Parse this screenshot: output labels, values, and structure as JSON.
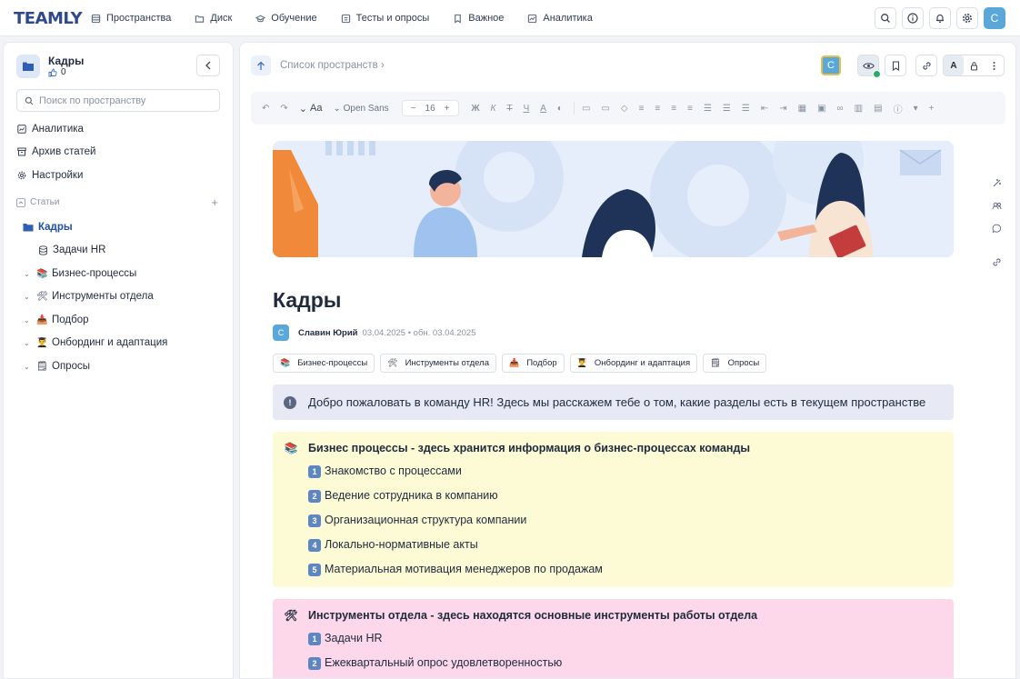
{
  "app": {
    "logo": "TEAMLY"
  },
  "nav": [
    {
      "label": "Пространства",
      "icon": "spaces-icon"
    },
    {
      "label": "Диск",
      "icon": "folder-icon"
    },
    {
      "label": "Обучение",
      "icon": "graduation-cap-icon"
    },
    {
      "label": "Тесты и опросы",
      "icon": "quiz-icon"
    },
    {
      "label": "Важное",
      "icon": "bookmark-icon"
    },
    {
      "label": "Аналитика",
      "icon": "analytics-icon"
    }
  ],
  "top_right": {
    "avatar": "С"
  },
  "sidebar": {
    "space_title": "Кадры",
    "likes": "0",
    "search_placeholder": "Поиск по пространству",
    "links": [
      {
        "label": "Аналитика",
        "icon": "analytics-icon"
      },
      {
        "label": "Архив статей",
        "icon": "archive-icon"
      },
      {
        "label": "Настройки",
        "icon": "gear-icon"
      }
    ],
    "section_label": "Статьи",
    "tree": [
      {
        "label": "Кадры",
        "emoji": "📁"
      },
      {
        "label": "Задачи HR",
        "emoji": "🗄"
      },
      {
        "label": "Бизнес-процессы",
        "emoji": "📚"
      },
      {
        "label": "Инструменты отдела",
        "emoji": "🛠"
      },
      {
        "label": "Подбор",
        "emoji": "📥"
      },
      {
        "label": "Онбординг и адаптация",
        "emoji": "👨‍🎓"
      },
      {
        "label": "Опросы",
        "emoji": "🗒"
      }
    ]
  },
  "main": {
    "breadcrumb": "Список пространств",
    "avatar": "С",
    "editor_toolbar": {
      "font": "Open Sans",
      "size": "16",
      "format_text_label": "Aa",
      "buttons": [
        "Ж",
        "К",
        "Т",
        "Ч"
      ]
    },
    "title": "Кадры",
    "author": "Славин Юрий",
    "author_initial": "С",
    "dates": "03.04.2025 • обн. 03.04.2025",
    "chips": [
      {
        "label": "Бизнес-процессы",
        "emoji": "📚"
      },
      {
        "label": "Инструменты отдела",
        "emoji": "🛠"
      },
      {
        "label": "Подбор",
        "emoji": "📥"
      },
      {
        "label": "Онбординг и адаптация",
        "emoji": "👨‍🎓"
      },
      {
        "label": "Опросы",
        "emoji": "🗒"
      }
    ],
    "notice": "Добро пожаловать в команду HR! Здесь мы расскажем тебе о том, какие разделы есть в текущем пространстве",
    "blocks": [
      {
        "emoji": "📚",
        "heading": "Бизнес процессы - здесь хранится информация о бизнес-процессах команды",
        "items": [
          {
            "num": "1",
            "label": "Знакомство с процессами"
          },
          {
            "num": "2",
            "label": "Ведение сотрудника в компанию"
          },
          {
            "num": "3",
            "label": "Организационная структура компании"
          },
          {
            "num": "4",
            "label": "Локально-нормативные акты"
          },
          {
            "num": "5",
            "label": "Материальная мотивация менеджеров по продажам"
          }
        ]
      },
      {
        "emoji": "🛠",
        "heading": "Инструменты отдела - здесь находятся основные инструменты работы отдела",
        "items": [
          {
            "num": "1",
            "label": "Задачи HR"
          },
          {
            "num": "2",
            "label": "Ежеквартальный опрос удовлетворенностью"
          }
        ]
      }
    ]
  },
  "colors": {
    "accent": "#1f4fa8",
    "avatar": "#5aa8d9",
    "notice_bg": "#e7e9f4",
    "yellow_block": "#fdfbd6",
    "pink_block": "#fcd8ea"
  }
}
